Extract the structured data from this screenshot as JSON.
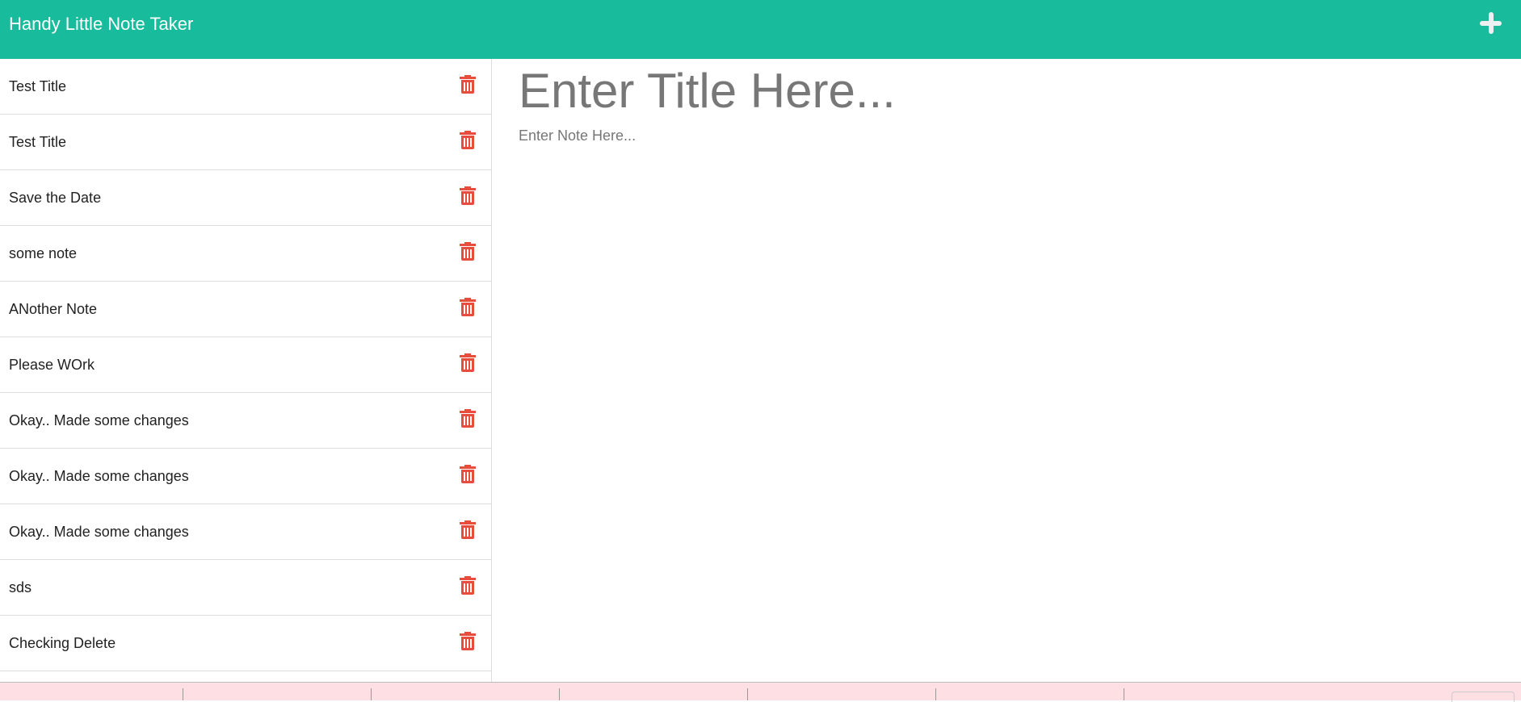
{
  "header": {
    "title": "Handy Little Note Taker",
    "new_note_icon": "plus-icon"
  },
  "notes": [
    {
      "title": "Test Title"
    },
    {
      "title": "Test Title"
    },
    {
      "title": "Save the Date"
    },
    {
      "title": "some note"
    },
    {
      "title": "ANother Note"
    },
    {
      "title": "Please WOrk"
    },
    {
      "title": "Okay.. Made some changes"
    },
    {
      "title": "Okay.. Made some changes"
    },
    {
      "title": "Okay.. Made some changes"
    },
    {
      "title": "sds"
    },
    {
      "title": "Checking Delete"
    },
    {
      "title": ""
    }
  ],
  "editor": {
    "title_placeholder": "Enter Title Here...",
    "note_placeholder": "Enter Note Here..."
  },
  "colors": {
    "header": "#18bc9c",
    "delete": "#e74c3c",
    "bottom_bar": "#fddfe4"
  }
}
